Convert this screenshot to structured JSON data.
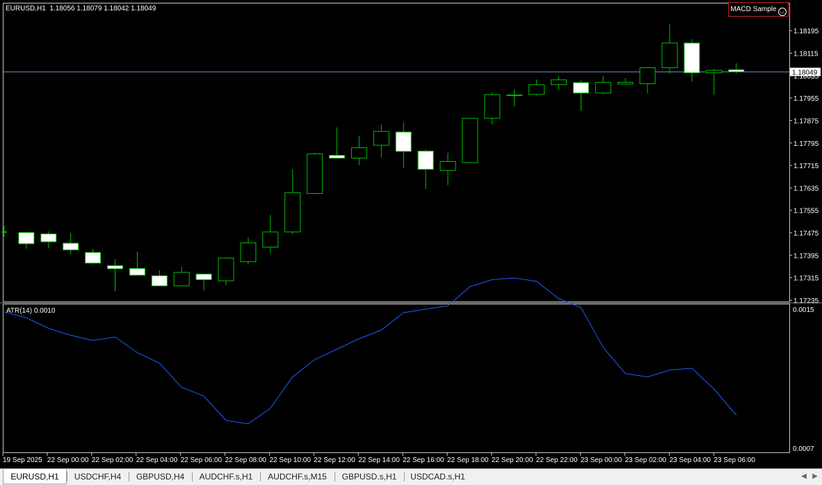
{
  "chart_header": {
    "label": "EURUSD,H1  1.18056 1.18079 1.18042 1.18049"
  },
  "expert_advisor": {
    "name": "MACD Sample"
  },
  "current_price_label": "1.18049",
  "indicator_header": {
    "label": "ATR(14) 0.0010"
  },
  "colors": {
    "background": "#000000",
    "bull_body": "#000000",
    "bear_body": "#ffffff",
    "wick": "#00c000",
    "price_line": "#6a8cb8",
    "atr_line": "#1e5cff",
    "frame": "#c8c8c8"
  },
  "tabs": [
    {
      "label": "EURUSD,H1",
      "active": true
    },
    {
      "label": "USDCHF,H4",
      "active": false
    },
    {
      "label": "GBPUSD,H4",
      "active": false
    },
    {
      "label": "AUDCHF.s,H1",
      "active": false
    },
    {
      "label": "AUDCHF.s,M15",
      "active": false
    },
    {
      "label": "GBPUSD.s,H1",
      "active": false
    },
    {
      "label": "USDCAD.s,H1",
      "active": false
    }
  ],
  "chart_data": [
    {
      "type": "candlestick",
      "title": "EURUSD,H1",
      "ylim": [
        1.17235,
        1.18235
      ],
      "y_ticks": [
        "1.18195",
        "1.18115",
        "1.18035",
        "1.17955",
        "1.17875",
        "1.17795",
        "1.17715",
        "1.17635",
        "1.17555",
        "1.17475",
        "1.17395",
        "1.17315",
        "1.17235"
      ],
      "x_tick_labels": [
        "19 Sep 2025",
        "22 Sep 00:00",
        "22 Sep 02:00",
        "22 Sep 04:00",
        "22 Sep 06:00",
        "22 Sep 08:00",
        "22 Sep 10:00",
        "22 Sep 12:00",
        "22 Sep 14:00",
        "22 Sep 16:00",
        "22 Sep 18:00",
        "22 Sep 20:00",
        "22 Sep 22:00",
        "23 Sep 00:00",
        "23 Sep 02:00",
        "23 Sep 04:00",
        "23 Sep 06:00"
      ],
      "current_price": 1.18049,
      "candles": [
        {
          "o": 1.17479,
          "h": 1.175,
          "l": 1.1746,
          "c": 1.17479
        },
        {
          "o": 1.17476,
          "h": 1.17478,
          "l": 1.17418,
          "c": 1.17436
        },
        {
          "o": 1.17471,
          "h": 1.1748,
          "l": 1.1742,
          "c": 1.17443
        },
        {
          "o": 1.17438,
          "h": 1.17474,
          "l": 1.17399,
          "c": 1.17414
        },
        {
          "o": 1.17405,
          "h": 1.17418,
          "l": 1.17362,
          "c": 1.17367
        },
        {
          "o": 1.17358,
          "h": 1.17381,
          "l": 1.17267,
          "c": 1.17347
        },
        {
          "o": 1.17348,
          "h": 1.17408,
          "l": 1.17326,
          "c": 1.17324
        },
        {
          "o": 1.17322,
          "h": 1.17341,
          "l": 1.17285,
          "c": 1.17286
        },
        {
          "o": 1.17286,
          "h": 1.17353,
          "l": 1.17284,
          "c": 1.17334
        },
        {
          "o": 1.17328,
          "h": 1.17328,
          "l": 1.17269,
          "c": 1.17308
        },
        {
          "o": 1.17304,
          "h": 1.17372,
          "l": 1.17289,
          "c": 1.17385
        },
        {
          "o": 1.17372,
          "h": 1.17459,
          "l": 1.17362,
          "c": 1.17439
        },
        {
          "o": 1.17424,
          "h": 1.17539,
          "l": 1.174,
          "c": 1.17478
        },
        {
          "o": 1.17478,
          "h": 1.17701,
          "l": 1.1747,
          "c": 1.17618
        },
        {
          "o": 1.17615,
          "h": 1.1776,
          "l": 1.17612,
          "c": 1.17756
        },
        {
          "o": 1.17751,
          "h": 1.1785,
          "l": 1.17741,
          "c": 1.17741
        },
        {
          "o": 1.17741,
          "h": 1.1782,
          "l": 1.17716,
          "c": 1.17778
        },
        {
          "o": 1.17787,
          "h": 1.1786,
          "l": 1.17744,
          "c": 1.17836
        },
        {
          "o": 1.17834,
          "h": 1.17869,
          "l": 1.17705,
          "c": 1.17765
        },
        {
          "o": 1.17766,
          "h": 1.17772,
          "l": 1.17631,
          "c": 1.17701
        },
        {
          "o": 1.17697,
          "h": 1.1776,
          "l": 1.17644,
          "c": 1.17729
        },
        {
          "o": 1.17725,
          "h": 1.17885,
          "l": 1.17722,
          "c": 1.17883
        },
        {
          "o": 1.17883,
          "h": 1.17975,
          "l": 1.17861,
          "c": 1.17967
        },
        {
          "o": 1.17966,
          "h": 1.17986,
          "l": 1.17924,
          "c": 1.17966
        },
        {
          "o": 1.17968,
          "h": 1.18021,
          "l": 1.17964,
          "c": 1.18003
        },
        {
          "o": 1.18003,
          "h": 1.18033,
          "l": 1.17985,
          "c": 1.1802
        },
        {
          "o": 1.1801,
          "h": 1.18018,
          "l": 1.17909,
          "c": 1.17973
        },
        {
          "o": 1.17973,
          "h": 1.18034,
          "l": 1.17968,
          "c": 1.18011
        },
        {
          "o": 1.18005,
          "h": 1.18026,
          "l": 1.18003,
          "c": 1.18011
        },
        {
          "o": 1.18006,
          "h": 1.18066,
          "l": 1.17972,
          "c": 1.18063
        },
        {
          "o": 1.18063,
          "h": 1.18218,
          "l": 1.18043,
          "c": 1.18151
        },
        {
          "o": 1.18151,
          "h": 1.18165,
          "l": 1.18014,
          "c": 1.18045
        },
        {
          "o": 1.18045,
          "h": 1.18059,
          "l": 1.17966,
          "c": 1.18054
        },
        {
          "o": 1.18056,
          "h": 1.18079,
          "l": 1.18042,
          "c": 1.18049
        }
      ]
    },
    {
      "type": "line",
      "title": "ATR(14) 0.0010",
      "ylim": [
        0.0007,
        0.0015
      ],
      "y_ticks": [
        "0.0015",
        "0.0007"
      ],
      "series": [
        {
          "values": [
            0.001485,
            0.00145,
            0.00139,
            0.00135,
            0.00132,
            0.00134,
            0.00125,
            0.00119,
            0.00105,
            0.001,
            0.00086,
            0.00084,
            0.00093,
            0.00111,
            0.00121,
            0.00127,
            0.00133,
            0.00138,
            0.00148,
            0.0015,
            0.00152,
            0.00163,
            0.00167,
            0.00168,
            0.00166,
            0.00156,
            0.00151,
            0.00128,
            0.00113,
            0.00111,
            0.00115,
            0.00116,
            0.00104,
            0.00089
          ]
        }
      ]
    }
  ]
}
